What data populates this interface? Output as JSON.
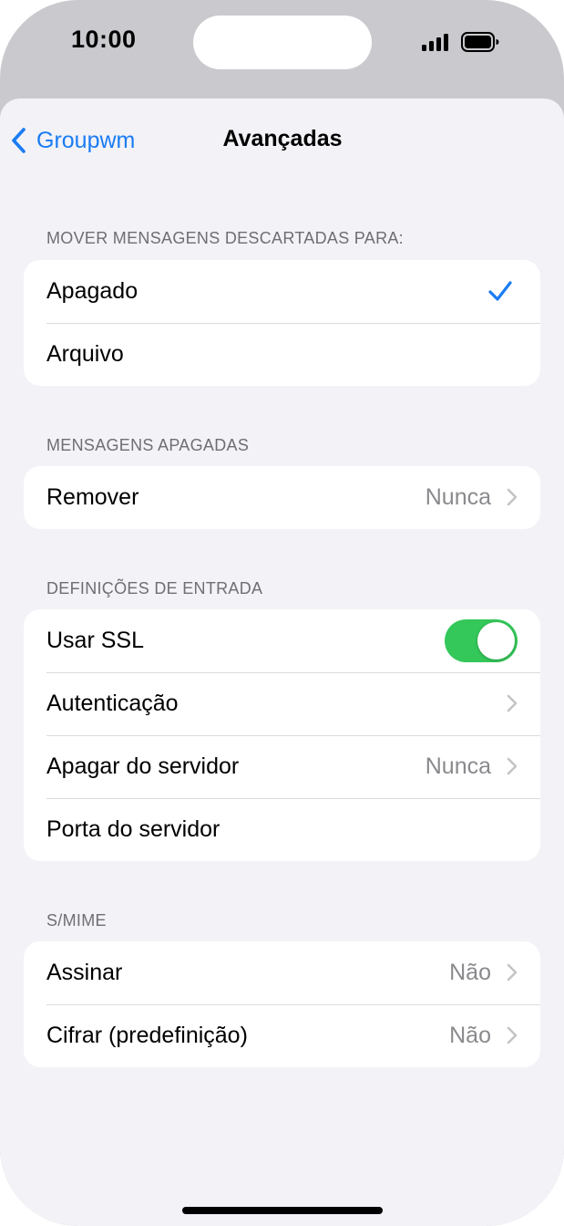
{
  "status_bar": {
    "time": "10:00"
  },
  "nav": {
    "back_label": "Groupwm",
    "title": "Avançadas"
  },
  "sections": [
    {
      "header": "MOVER MENSAGENS DESCARTADAS PARA:",
      "rows": [
        {
          "label": "Apagado",
          "selected": true
        },
        {
          "label": "Arquivo",
          "selected": false
        }
      ]
    },
    {
      "header": "MENSAGENS APAGADAS",
      "rows": [
        {
          "label": "Remover",
          "value": "Nunca"
        }
      ]
    },
    {
      "header": "DEFINIÇÕES DE ENTRADA",
      "rows": [
        {
          "label": "Usar SSL",
          "toggle": true
        },
        {
          "label": "Autenticação",
          "value": ""
        },
        {
          "label": "Apagar do servidor",
          "value": "Nunca"
        },
        {
          "label": "Porta do servidor",
          "value": ""
        }
      ]
    },
    {
      "header": "S/MIME",
      "rows": [
        {
          "label": "Assinar",
          "value": "Não"
        },
        {
          "label": "Cifrar (predefinição)",
          "value": "Não"
        }
      ]
    }
  ],
  "colors": {
    "accent": "#1a7cf3",
    "toggle_on": "#34c759",
    "background": "#f2f2f7",
    "secondary_text": "#8a8a8e"
  },
  "icons": [
    "back-chevron-icon",
    "checkmark-icon",
    "chevron-right-icon",
    "signal-icon",
    "battery-icon"
  ]
}
